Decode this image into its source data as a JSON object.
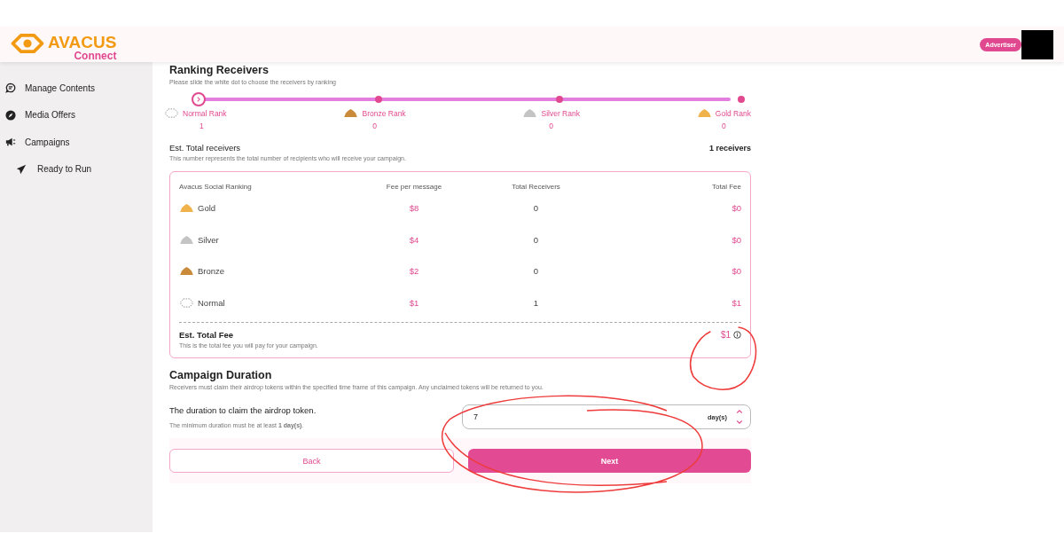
{
  "header": {
    "brand": "AVACUS",
    "product": "Connect",
    "role_badge": "Advertiser"
  },
  "sidebar": {
    "items": [
      {
        "label": "Manage Contents"
      },
      {
        "label": "Media Offers"
      },
      {
        "label": "Campaigns",
        "children": [
          {
            "label": "Ready to Run"
          }
        ]
      }
    ]
  },
  "ranking": {
    "title": "Ranking Receivers",
    "hint": "Please slide the white dot to choose the receivers by ranking",
    "level": 0,
    "stops": [
      {
        "label": "Normal Rank",
        "kind": "normal",
        "count": "1"
      },
      {
        "label": "Bronze Rank",
        "kind": "bronze",
        "count": "0"
      },
      {
        "label": "Silver Rank",
        "kind": "silver",
        "count": "0"
      },
      {
        "label": "Gold Rank",
        "kind": "gold",
        "count": "0"
      }
    ]
  },
  "receivers": {
    "title": "Est. Total receivers",
    "value": "1 receivers",
    "hint": "This number represents the total number of recipients who will receive your campaign."
  },
  "fee_table": {
    "columns": [
      "Avacus Social Ranking",
      "Fee per message",
      "Total Receivers",
      "Total Fee"
    ],
    "rows": [
      {
        "rank": "Gold",
        "kind": "gold",
        "fee": "$8",
        "receivers": "0",
        "total": "$0"
      },
      {
        "rank": "Silver",
        "kind": "silver",
        "fee": "$4",
        "receivers": "0",
        "total": "$0"
      },
      {
        "rank": "Bronze",
        "kind": "bronze",
        "fee": "$2",
        "receivers": "0",
        "total": "$0"
      },
      {
        "rank": "Normal",
        "kind": "normal",
        "fee": "$1",
        "receivers": "1",
        "total": "$1"
      }
    ],
    "total_label": "Est. Total Fee",
    "total_value": "$1",
    "total_hint": "This is the total fee you will pay for your campaign."
  },
  "duration": {
    "title": "Campaign Duration",
    "hint": "Receivers must claim their airdrop tokens within the specified time frame of this campaign. Any unclaimed tokens will be returned to you.",
    "label": "The duration to claim the airdrop token.",
    "note": "The minimum duration must be at least **1 day(s)**.",
    "value": "7",
    "unit": "day(s)"
  },
  "buttons": {
    "back": "Back",
    "next": "Next"
  }
}
